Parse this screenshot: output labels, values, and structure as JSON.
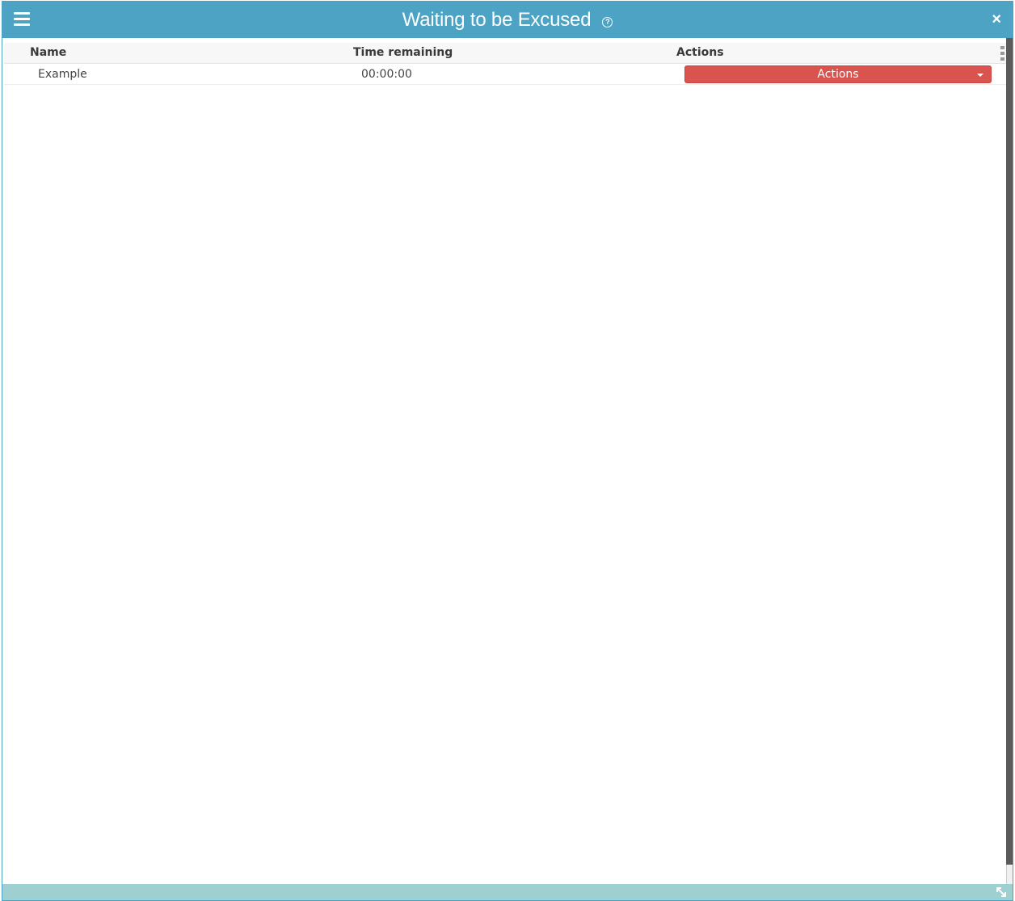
{
  "window": {
    "title": "Waiting to be Excused",
    "help_glyph": "?",
    "close_glyph": "×",
    "colors": {
      "titlebar": "#4ca3c3",
      "footer": "#9fd0d1",
      "action_button": "#d9534f"
    }
  },
  "icons": {
    "menu": "hamburger-menu-icon",
    "help": "help-circle-icon",
    "close": "close-icon",
    "column_menu": "column-menu-icon",
    "dropdown": "caret-down-icon",
    "resize": "resize-diagonal-icon"
  },
  "table": {
    "columns": [
      "Name",
      "Time remaining",
      "Actions"
    ],
    "rows": [
      {
        "name": "Example",
        "time_remaining": "00:00:00",
        "action_label": "Actions"
      }
    ]
  }
}
